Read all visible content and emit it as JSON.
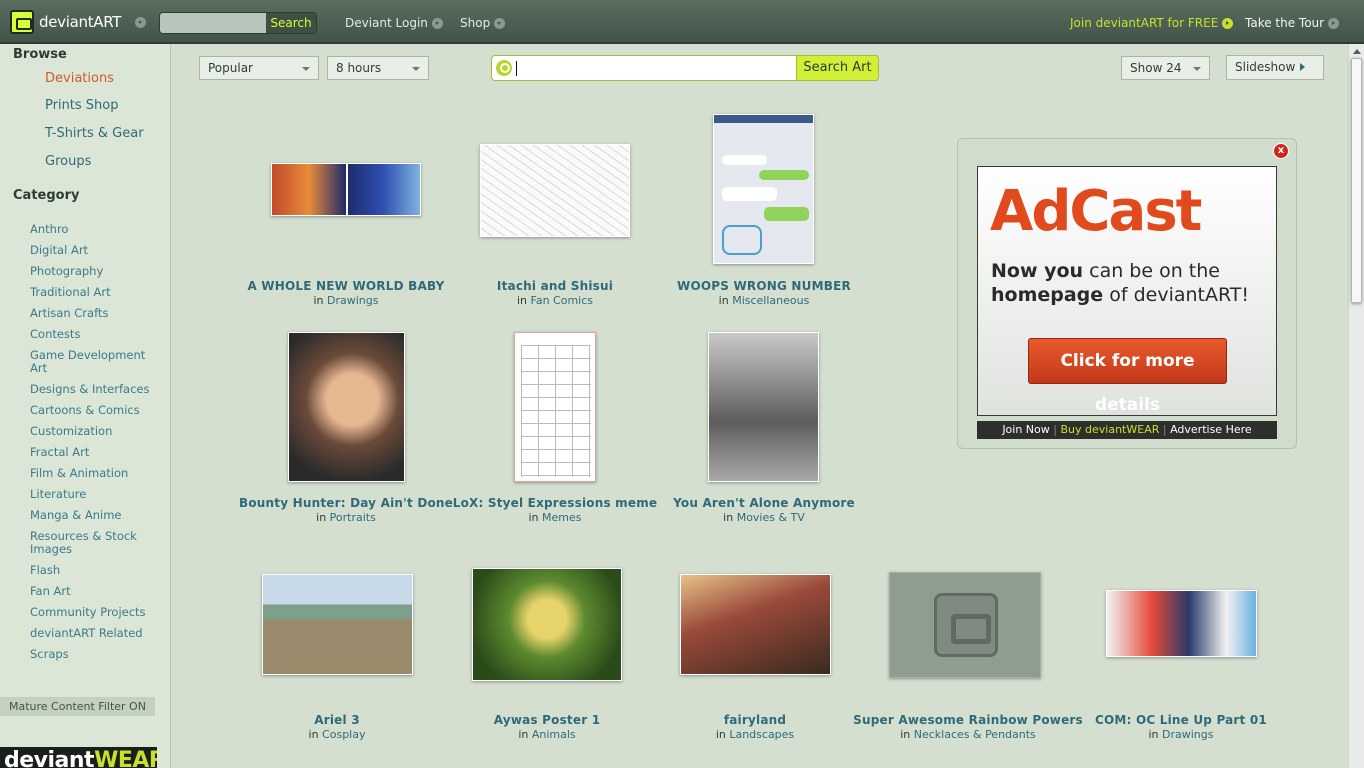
{
  "topbar": {
    "logo_text": "deviantART",
    "search_button": "Search",
    "deviant_login": "Deviant Login",
    "shop": "Shop",
    "join": "Join deviantART for FREE",
    "tour": "Take the Tour",
    "accent_color": "#c7e02e"
  },
  "sidebar": {
    "browse_title": "Browse",
    "browse_items": [
      {
        "label": "Deviations",
        "active": true
      },
      {
        "label": "Prints Shop"
      },
      {
        "label": "T-Shirts & Gear"
      },
      {
        "label": "Groups"
      }
    ],
    "category_title": "Category",
    "categories": [
      "Anthro",
      "Digital Art",
      "Photography",
      "Traditional Art",
      "Artisan Crafts",
      "Contests",
      "Game Development Art",
      "Designs & Interfaces",
      "Cartoons & Comics",
      "Customization",
      "Fractal Art",
      "Film & Animation",
      "Literature",
      "Manga & Anime",
      "Resources & Stock Images",
      "Flash",
      "Fan Art",
      "Community Projects",
      "deviantART Related",
      "Scraps"
    ],
    "mature_filter": "Mature Content Filter ON",
    "dwear_banner": "deviantWEAR"
  },
  "toolbar": {
    "sort": "Popular",
    "time": "8 hours",
    "search_value": "",
    "search_button": "Search Art",
    "show": "Show 24",
    "slideshow": "Slideshow"
  },
  "gallery": {
    "in_word": "in",
    "tiles": [
      {
        "title": "A WHOLE NEW WORLD BABY",
        "category": "Drawings"
      },
      {
        "title": "Itachi and Shisui",
        "category": "Fan Comics"
      },
      {
        "title": "WOOPS WRONG NUMBER",
        "category": "Miscellaneous"
      },
      {
        "title": "Bounty Hunter: Day Ain't Done",
        "category": "Portraits"
      },
      {
        "title": "LoX: Styel Expressions meme",
        "category": "Memes"
      },
      {
        "title": "You Aren't Alone Anymore",
        "category": "Movies & TV"
      },
      {
        "title": "Ariel 3",
        "category": "Cosplay"
      },
      {
        "title": "Aywas Poster 1",
        "category": "Animals"
      },
      {
        "title": "fairyland",
        "category": "Landscapes"
      },
      {
        "title": "Super Awesome Rainbow Powers",
        "category": "Necklaces & Pendants"
      },
      {
        "title": "COM: OC Line Up Part 01",
        "category": "Drawings"
      }
    ]
  },
  "ad": {
    "close": "x",
    "title": "AdCast",
    "line1_bold": "Now you",
    "line1_rest": " can be on the",
    "line2_bold": "homepage",
    "line2_rest": " of deviantART!",
    "cta": "Click for more details",
    "footer_join": "Join Now",
    "footer_buy": "Buy deviantWEAR",
    "footer_advertise": "Advertise Here",
    "brand_color": "#e04a1c"
  }
}
